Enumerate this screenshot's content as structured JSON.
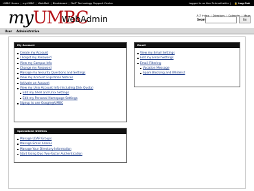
{
  "topbar": {
    "links": [
      "UMBC Home",
      "myUMBC",
      "WebMail",
      "Blackboard",
      "DoIT Technology Support Center"
    ],
    "login_status": "Logged in as Ken Schmelheifer",
    "logout_label": "Log Out"
  },
  "header": {
    "logo_my": "my",
    "logo_umbc": "UMBC",
    "app_title": "WebAdmin",
    "toplinks": [
      "A-Z Index",
      "Directory",
      "Calendar",
      "Maps"
    ],
    "search_label": "Search:",
    "search_value": "",
    "go_label": "Go"
  },
  "nav": {
    "user": "User",
    "admin": "Administrative"
  },
  "panels": {
    "account": {
      "title": "My Account",
      "items": [
        "Create my Account",
        "I Forgot my Password",
        "View my Campus Info",
        "Change my Password",
        "Manage my Security Questions and Settings",
        "View my Account Expiration Notices",
        "Activate an Account",
        "View my Unix Account Info (Including Disk Quota)",
        "Edit my Shell and Unix Settings",
        "Edit my Personal Homepage Settings",
        "Signup to use Google@UMBC"
      ]
    },
    "email": {
      "title": "Email",
      "items": [
        "View my Email Settings",
        "Edit my Email Settings",
        "Email Filtering",
        "Vacation Message",
        "Spam Blocking and Whitelist"
      ]
    },
    "utilities": {
      "title": "Specialized Utilities",
      "items": [
        "Manage LDAP Groups",
        "Manage Email Aliases",
        "Manage Your Directory Information",
        "Start Using Duo Two-Factor Authentication"
      ]
    }
  },
  "colors": {
    "brand_red": "#b51218",
    "link_blue": "#1a3a8a",
    "panel_header": "#111111",
    "nav_bg": "#d9d9d9"
  }
}
